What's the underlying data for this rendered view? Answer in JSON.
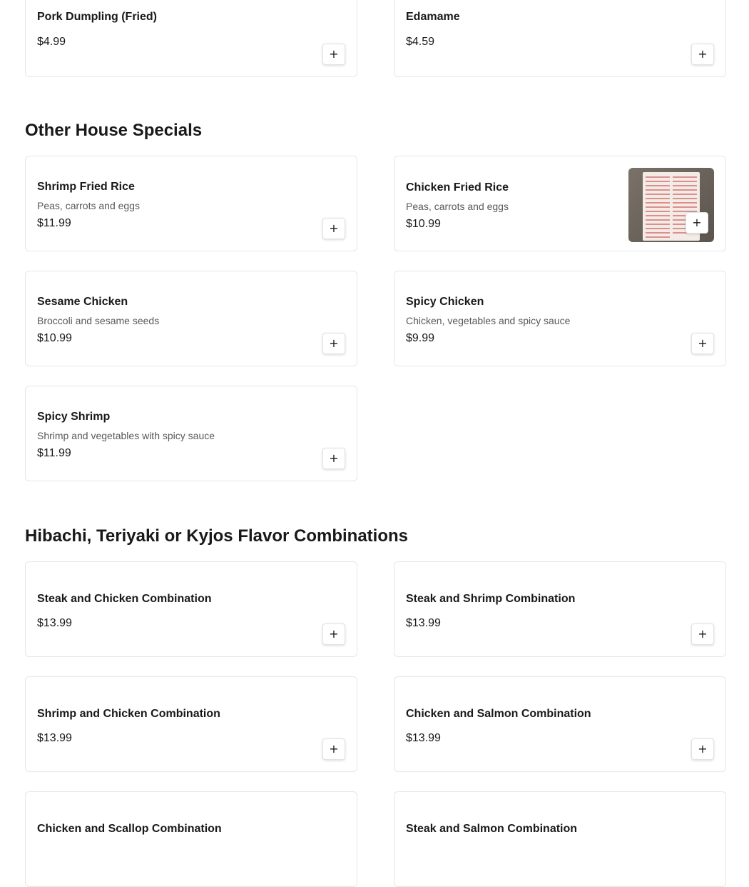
{
  "sections": [
    {
      "items": [
        {
          "name": "Pork Dumpling (Fried)",
          "price": "$4.99"
        },
        {
          "name": "Edamame",
          "price": "$4.59"
        }
      ]
    },
    {
      "title": "Other House Specials",
      "items": [
        {
          "name": "Shrimp Fried Rice",
          "description": "Peas, carrots and eggs",
          "price": "$11.99"
        },
        {
          "name": "Chicken Fried Rice",
          "description": "Peas, carrots and eggs",
          "price": "$10.99",
          "has_image": true
        },
        {
          "name": "Sesame Chicken",
          "description": "Broccoli and sesame seeds",
          "price": "$10.99"
        },
        {
          "name": "Spicy Chicken",
          "description": "Chicken, vegetables and spicy sauce",
          "price": "$9.99"
        },
        {
          "name": "Spicy Shrimp",
          "description": "Shrimp and vegetables with spicy sauce",
          "price": "$11.99"
        }
      ]
    },
    {
      "title": "Hibachi, Teriyaki or Kyjos Flavor Combinations",
      "items": [
        {
          "name": "Steak and Chicken Combination",
          "price": "$13.99"
        },
        {
          "name": "Steak and Shrimp Combination",
          "price": "$13.99"
        },
        {
          "name": "Shrimp and Chicken Combination",
          "price": "$13.99"
        },
        {
          "name": "Chicken and Salmon Combination",
          "price": "$13.99"
        },
        {
          "name": "Chicken and Scallop Combination",
          "price": ""
        },
        {
          "name": "Steak and Salmon Combination",
          "price": ""
        }
      ]
    }
  ],
  "icons": {
    "add": "plus-icon",
    "add_glyph": "+"
  }
}
